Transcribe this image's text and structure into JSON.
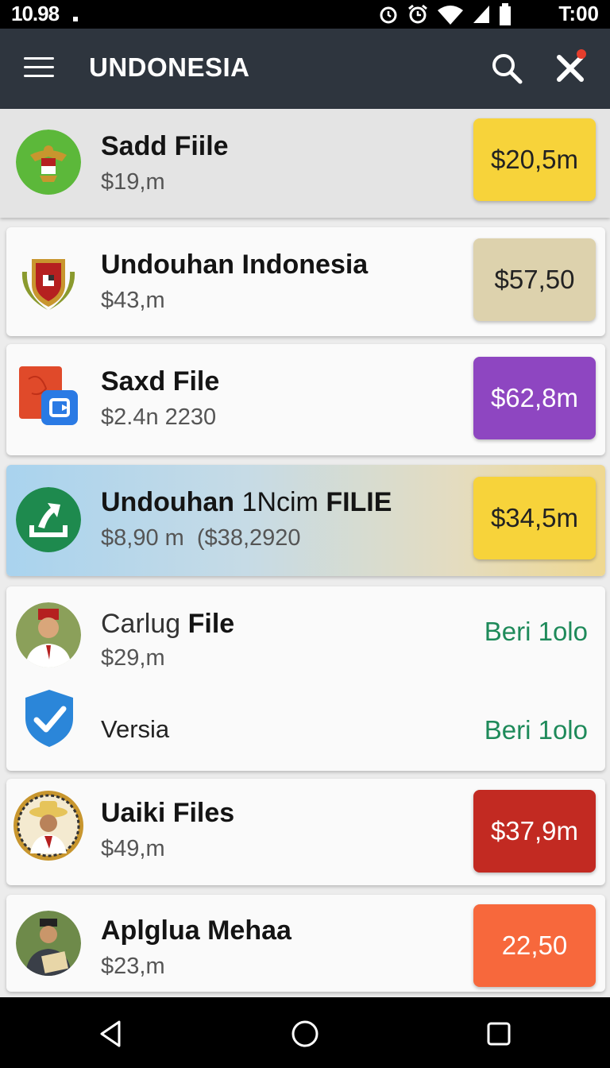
{
  "status_bar": {
    "time_left": "10.98",
    "time_right": "T:00"
  },
  "app_bar": {
    "title": "UNDONESIA"
  },
  "items": [
    {
      "name": "Sadd Fiile",
      "sub": "$19,m",
      "price": "$20,5m",
      "price_bg": "#f7d33a",
      "price_color": "#222222"
    },
    {
      "name": "Undouhan Indonesia",
      "sub": "$43,m",
      "price": "$57,50",
      "price_bg": "#ddd2ad",
      "price_color": "#222222"
    },
    {
      "name": "Saxd File",
      "sub": "$2.4n 2230",
      "price": "$62,8m",
      "price_bg": "#8e46c1",
      "price_color": "#ffffff"
    },
    {
      "name_part1": "Undouhan",
      "name_part2": "1Ncim",
      "name_part3": "FILIE",
      "sub": "$8,90 m  ($38,2920",
      "price": "$34,5m",
      "price_bg": "#f7d33a",
      "price_color": "#222222"
    },
    {
      "name_part1": "Carlug",
      "name_part2": "File",
      "sub": "$29,m",
      "action": "Beri 1olo",
      "second_label": "Versia",
      "second_action": "Beri 1olo"
    },
    {
      "name": "Uaiki Files",
      "sub": "$49,m",
      "price": "$37,9m",
      "price_bg": "#c22a22",
      "price_color": "#ffffff"
    },
    {
      "name": "Aplglua Mehaa",
      "sub": "$23,m",
      "price": "22,50",
      "price_bg": "#f7683c",
      "price_color": "#ffffff"
    }
  ],
  "colors": {
    "app_bar": "#2e353e",
    "accent_green": "#1e8a5a",
    "badge_red": "#e53d2c"
  }
}
